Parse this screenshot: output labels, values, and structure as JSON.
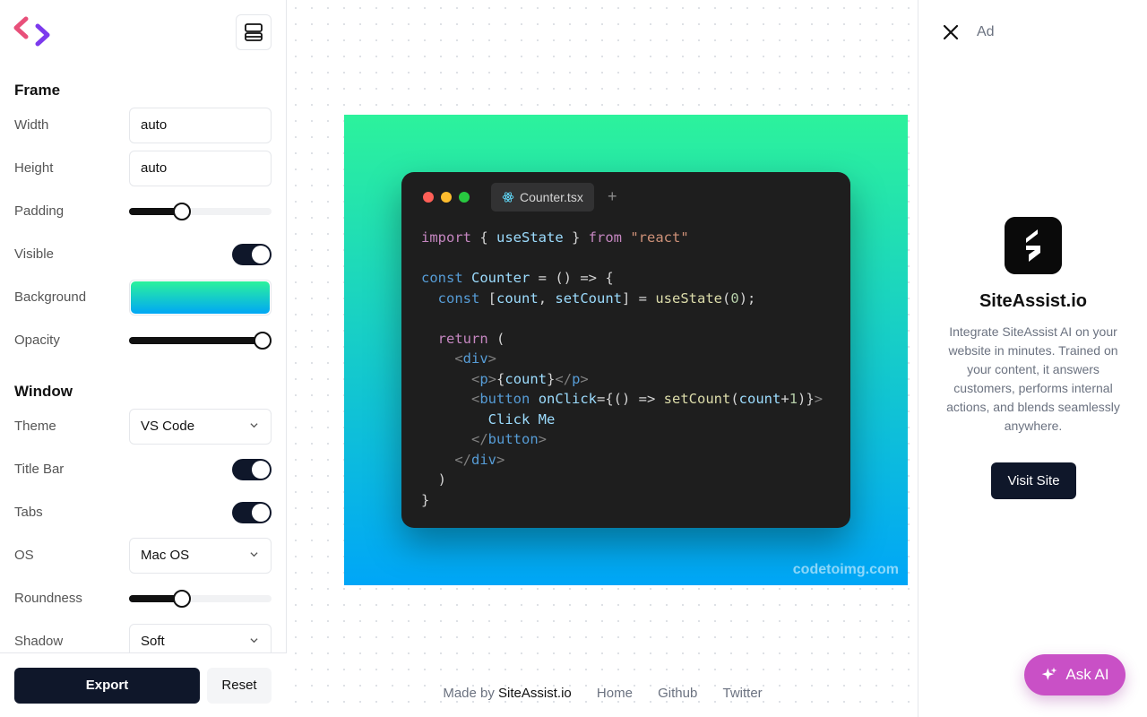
{
  "sidebar": {
    "sections": {
      "frame": "Frame",
      "window": "Window"
    },
    "labels": {
      "width": "Width",
      "height": "Height",
      "padding": "Padding",
      "visible": "Visible",
      "background": "Background",
      "opacity": "Opacity",
      "theme": "Theme",
      "title_bar": "Title Bar",
      "tabs": "Tabs",
      "os": "OS",
      "roundness": "Roundness",
      "shadow": "Shadow"
    },
    "values": {
      "width": "auto",
      "height": "auto",
      "theme": "VS Code",
      "os": "Mac OS",
      "shadow": "Soft"
    },
    "sliders": {
      "padding": 0.35,
      "opacity": 1.0,
      "roundness": 0.35
    },
    "toggles": {
      "visible": true,
      "title_bar": true,
      "tabs": true
    },
    "background_gradient": [
      "#2cf29c",
      "#00a7f5"
    ],
    "buttons": {
      "export": "Export",
      "reset": "Reset"
    }
  },
  "editor": {
    "tab_name": "Counter.tsx",
    "watermark": "codetoimg.com",
    "traffic_lights": [
      "#ff5f57",
      "#febc2e",
      "#28c840"
    ]
  },
  "footer": {
    "made_by": "Made by",
    "brand": "SiteAssist.io",
    "links": [
      "Home",
      "Github",
      "Twitter"
    ]
  },
  "ad": {
    "label": "Ad",
    "title": "SiteAssist.io",
    "description": "Integrate SiteAssist AI on your website in minutes. Trained on your content, it answers customers, performs internal actions, and blends seamlessly anywhere.",
    "cta": "Visit Site"
  },
  "ask_ai": "Ask AI",
  "colors": {
    "accent_dark": "#0f172a",
    "ask_ai": "#c950c6"
  }
}
